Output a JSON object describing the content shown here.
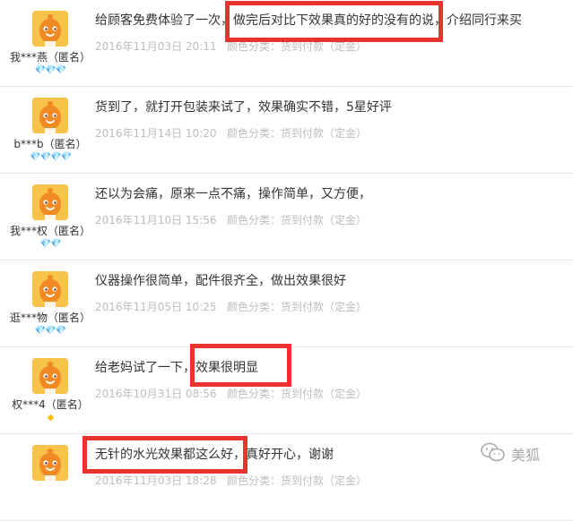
{
  "reviews": [
    {
      "nickname": "我***燕（匿名）",
      "rank": "💎💎💎",
      "rank_color": "#ff3355",
      "text": "给顾客免费体验了一次，做完后对比下效果真的好的没有的说，介绍同行来买",
      "date": "2016年11月03日 20:11",
      "sku": "颜色分类：货到付款（定金）"
    },
    {
      "nickname": "b***b（匿名）",
      "rank": "💎💎💎💎",
      "rank_color": "#ff3355",
      "text": "货到了，就打开包装来试了，效果确实不错，5星好评",
      "date": "2016年11月14日 10:20",
      "sku": "颜色分类：货到付款（定金）"
    },
    {
      "nickname": "我***权（匿名）",
      "rank": "💎💎",
      "rank_color": "#ff3355",
      "text": "还以为会痛，原来一点不痛，操作简单，又方便，",
      "date": "2016年11月10日 15:56",
      "sku": "颜色分类：货到付款（定金）"
    },
    {
      "nickname": "逛***物（匿名）",
      "rank": "💎💎💎",
      "rank_color": "#ff3355",
      "text": "仪器操作很简单，配件很齐全，做出效果很好",
      "date": "2016年11月05日 10:25",
      "sku": "颜色分类：货到付款（定金）"
    },
    {
      "nickname": "权***4（匿名）",
      "rank": "◆",
      "rank_color": "#ffbb00",
      "text": "给老妈试了一下，效果很明显",
      "date": "2016年10月31日 08:56",
      "sku": "颜色分类：货到付款（定金）"
    },
    {
      "nickname": "",
      "rank": "",
      "rank_color": "#ff3355",
      "text": "无针的水光效果都这么好，真好开心，谢谢",
      "date": "2016年11月03日 18:28",
      "sku": "颜色分类：货到付款（定金）"
    }
  ],
  "colors": {
    "highlight": "#e8332e",
    "avatar_bg": "#f7c34a",
    "avatar_face": "#f08a24"
  },
  "watermark": {
    "icon": "wechat-icon",
    "text": "美狐"
  }
}
